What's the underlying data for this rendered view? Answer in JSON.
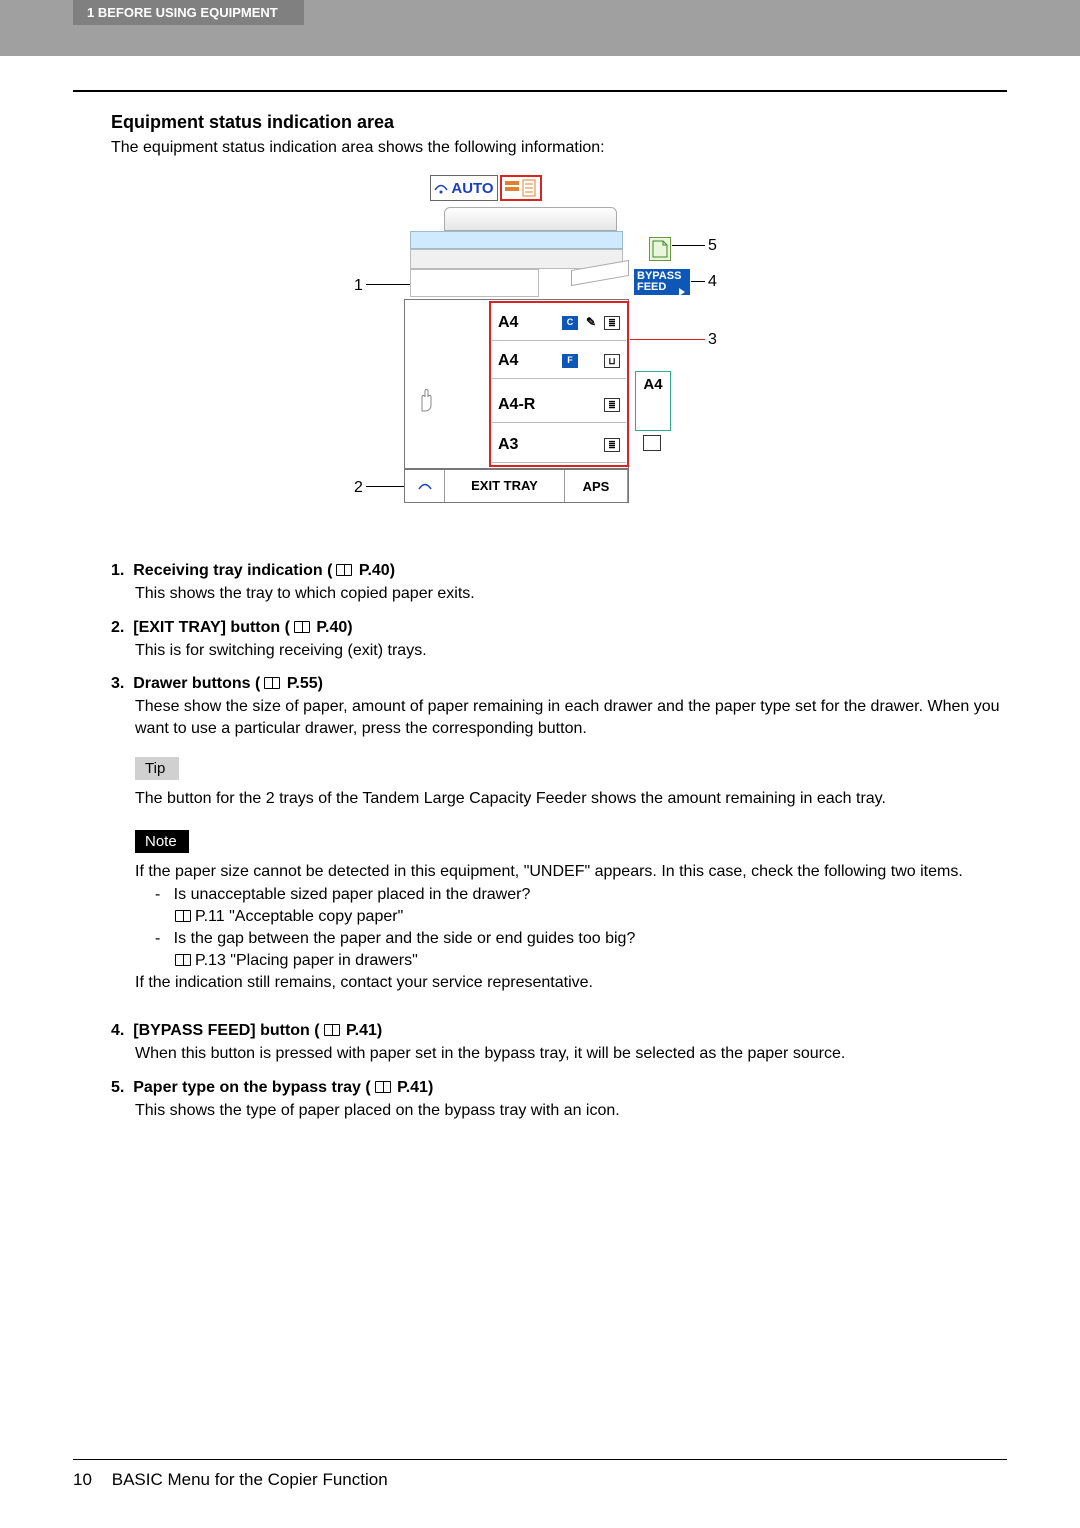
{
  "header": {
    "chapter": "1 BEFORE USING EQUIPMENT"
  },
  "section": {
    "heading": "Equipment status indication area",
    "intro": "The equipment status indication area shows the following information:"
  },
  "diagram": {
    "auto_label": "AUTO",
    "bypass_label": "BYPASS FEED",
    "drawers": [
      {
        "size": "A4",
        "icons": [
          "C",
          "key",
          "tray"
        ]
      },
      {
        "size": "A4",
        "icons": [
          "F",
          "",
          "tray-open"
        ]
      },
      {
        "size": "A4-R",
        "icons": [
          "",
          "",
          "tray"
        ]
      },
      {
        "size": "A3",
        "icons": [
          "",
          "",
          "tray"
        ]
      }
    ],
    "side_size": "A4",
    "exit_tray": "EXIT TRAY",
    "aps": "APS",
    "callouts": {
      "c1": "1",
      "c2": "2",
      "c3": "3",
      "c4": "4",
      "c5": "5"
    }
  },
  "items": [
    {
      "num": "1.",
      "title": "Receiving tray indication (",
      "page": "P.40)",
      "desc": "This shows the tray to which copied paper exits."
    },
    {
      "num": "2.",
      "title": "[EXIT TRAY] button (",
      "page": "P.40)",
      "desc": "This is for switching receiving (exit) trays."
    },
    {
      "num": "3.",
      "title": "Drawer buttons (",
      "page": "P.55)",
      "desc": "These show the size of paper, amount of paper remaining in each drawer and the paper type set for the drawer. When you want to use a particular drawer, press the corresponding button."
    }
  ],
  "tip": {
    "label": "Tip",
    "text": "The button for the 2 trays of the Tandem Large Capacity Feeder shows the amount remaining in each tray."
  },
  "note": {
    "label": "Note",
    "intro": "If the paper size cannot be detected in this equipment, \"UNDEF\" appears. In this case, check the following two items.",
    "bullets": [
      {
        "q": "Is unacceptable sized paper placed in the drawer?",
        "ref": "P.11 \"Acceptable copy paper\""
      },
      {
        "q": "Is the gap between the paper and the side or end guides too big?",
        "ref": "P.13 \"Placing paper in drawers\""
      }
    ],
    "outro": "If the indication still remains, contact your service representative."
  },
  "items2": [
    {
      "num": "4.",
      "title": "[BYPASS FEED] button (",
      "page": "P.41)",
      "desc": "When this button is pressed with paper set in the bypass tray, it will be selected as the paper source."
    },
    {
      "num": "5.",
      "title": "Paper type on the bypass tray (",
      "page": "P.41)",
      "desc": "This shows the type of paper placed on the bypass tray with an icon."
    }
  ],
  "footer": {
    "page_number": "10",
    "title": "BASIC Menu for the Copier Function"
  }
}
